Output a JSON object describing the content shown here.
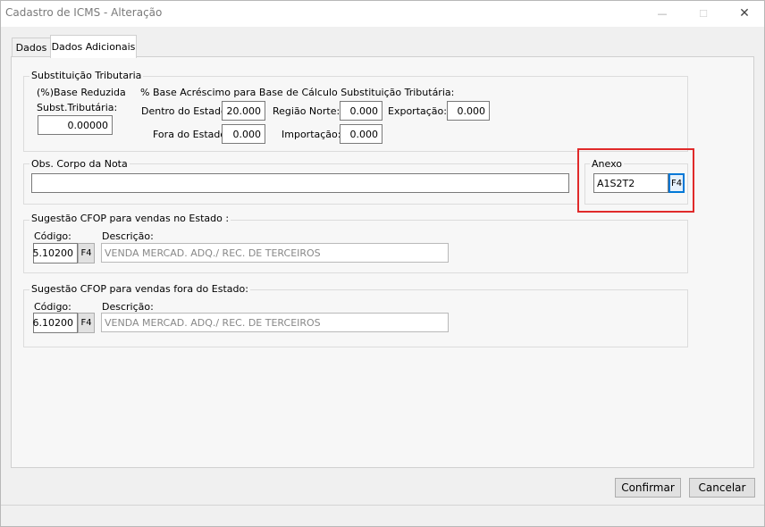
{
  "window": {
    "title": "Cadastro de ICMS - Alteração",
    "minimize_icon": "—",
    "maximize_icon": "☐",
    "close_icon": "✕"
  },
  "tabs": [
    {
      "label": "Dados"
    },
    {
      "label": "Dados Adicionais"
    }
  ],
  "subst": {
    "legend": "Substituição Tributaria",
    "base_reduzida_label_1": "(%)Base Reduzida",
    "base_reduzida_label_2": "Subst.Tributária:",
    "base_reduzida_value": "0.00000",
    "acrescimo_header": "% Base Acréscimo para Base de Cálculo Substituição Tributária:",
    "dentro_label": "Dentro do Estado:",
    "dentro_value": "20.000",
    "norte_label": "Região Norte:",
    "norte_value": "0.000",
    "exportacao_label": "Exportação:",
    "exportacao_value": "0.000",
    "fora_label": "Fora do Estado:",
    "fora_value": "0.000",
    "importacao_label": "Importação:",
    "importacao_value": "0.000"
  },
  "obs": {
    "legend": "Obs. Corpo da Nota",
    "value": ""
  },
  "anexo": {
    "legend": "Anexo",
    "value": "A1S2T2",
    "button": "F4"
  },
  "cfop_estado": {
    "legend": "Sugestão CFOP para vendas no Estado :",
    "codigo_label": "Código:",
    "descricao_label": "Descrição:",
    "codigo_value": "5.10200",
    "button": "F4",
    "descricao_value": "VENDA MERCAD. ADQ./ REC. DE TERCEIROS"
  },
  "cfop_fora": {
    "legend": "Sugestão CFOP para vendas fora do Estado:",
    "codigo_label": "Código:",
    "descricao_label": "Descrição:",
    "codigo_value": "6.10200",
    "button": "F4",
    "descricao_value": "VENDA MERCAD. ADQ./ REC. DE TERCEIROS"
  },
  "buttons": {
    "confirmar": "Confirmar",
    "cancelar": "Cancelar"
  },
  "colors": {
    "highlight": "#e02a2a",
    "focus": "#0078d7"
  }
}
